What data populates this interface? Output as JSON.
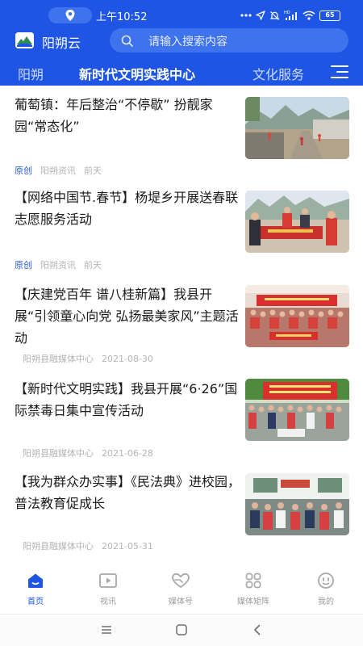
{
  "status_bar": {
    "time": "上午10:52",
    "battery": "65",
    "icons": [
      "location-icon",
      "more-dots-icon",
      "send-icon",
      "mute-icon",
      "hd-signal-icon",
      "wifi-icon",
      "battery-icon"
    ]
  },
  "header": {
    "app_name": "阳朔云",
    "search_placeholder": "请输入搜索内容"
  },
  "nav": {
    "tabs": [
      {
        "label": "阳朔",
        "active": false
      },
      {
        "label": "新时代文明实践中心",
        "active": true
      },
      {
        "label": "文化服务",
        "active": false
      }
    ]
  },
  "articles": [
    {
      "title": "葡萄镇：年后整治“不停歇” 扮靓家园“常态化”",
      "original_tag": "原创",
      "source": "阳朔资讯",
      "date": "前天"
    },
    {
      "title": "【网络中国节.春节】杨堤乡开展送春联志愿服务活动",
      "original_tag": "原创",
      "source": "阳朔资讯",
      "date": "前天"
    },
    {
      "title": "【庆建党百年 谱八桂新篇】我县开展“引领童心向党 弘扬最美家风”主题活动",
      "original_tag": "",
      "source": "阳朔县融媒体中心",
      "date": "2021-08-30"
    },
    {
      "title": "【新时代文明实践】我县开展“6·26”国际禁毒日集中宣传活动",
      "original_tag": "",
      "source": "阳朔县融媒体中心",
      "date": "2021-06-28"
    },
    {
      "title": "【我为群众办实事】《民法典》进校园，普法教育促成长",
      "original_tag": "",
      "source": "阳朔县融媒体中心",
      "date": "2021-05-31"
    }
  ],
  "tabbar": {
    "items": [
      {
        "label": "首页",
        "icon": "home-icon",
        "active": true
      },
      {
        "label": "视讯",
        "icon": "video-icon",
        "active": false
      },
      {
        "label": "媒体号",
        "icon": "heart-hands-icon",
        "active": false
      },
      {
        "label": "媒体矩阵",
        "icon": "grid-icon",
        "active": false
      },
      {
        "label": "我的",
        "icon": "face-icon",
        "active": false
      }
    ]
  },
  "colors": {
    "brand_blue": "#1e55e4",
    "original_tag": "#2a5fd8",
    "meta_gray": "#b4b4b4"
  }
}
